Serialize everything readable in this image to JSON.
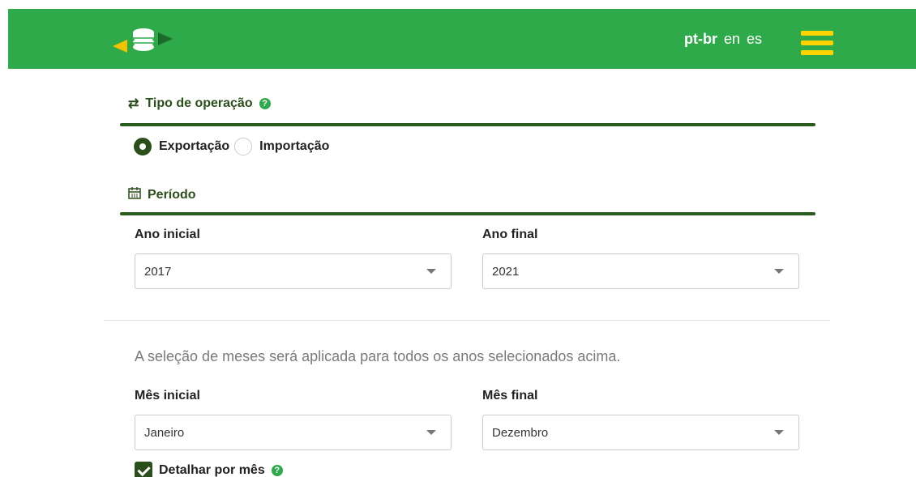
{
  "header": {
    "languages": [
      {
        "label": "pt-br",
        "active": true
      },
      {
        "label": "en",
        "active": false
      },
      {
        "label": "es",
        "active": false
      }
    ],
    "menu_icon": "hamburger-icon",
    "logo_icon": "coin-stack-arrows-icon",
    "colors": {
      "bar": "#2eaa4a",
      "menu": "#ffd400"
    }
  },
  "operation": {
    "title": "Tipo de operação",
    "icon": "exchange-arrows-icon",
    "help_icon": "question-circle-icon",
    "options": [
      {
        "label": "Exportação",
        "selected": true
      },
      {
        "label": "Importação",
        "selected": false
      }
    ]
  },
  "period": {
    "title": "Período",
    "icon": "calendar-icon",
    "start_year_label": "Ano inicial",
    "start_year_value": "2017",
    "end_year_label": "Ano final",
    "end_year_value": "2021"
  },
  "months": {
    "note": "A seleção de meses será aplicada para todos os anos selecionados acima.",
    "start_month_label": "Mês inicial",
    "start_month_value": "Janeiro",
    "end_month_label": "Mês final",
    "end_month_value": "Dezembro",
    "detail_label": "Detalhar por mês",
    "detail_checked": true
  },
  "accent_color": "#2a4f1a"
}
